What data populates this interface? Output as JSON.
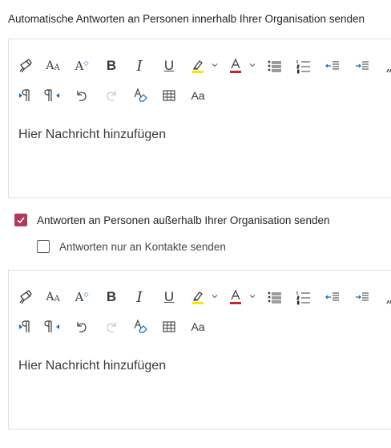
{
  "internal": {
    "title": "Automatische Antworten an Personen innerhalb Ihrer Organisation senden",
    "editor": {
      "placeholder": "Hier Nachricht hinzufügen"
    }
  },
  "external": {
    "reply_checkbox": {
      "label": "Antworten an Personen außerhalb Ihrer Organisation senden",
      "checked": true
    },
    "contacts_checkbox": {
      "label": "Antworten nur an Kontakte senden",
      "checked": false
    },
    "editor": {
      "placeholder": "Hier Nachricht hinzufügen"
    }
  },
  "toolbar": {
    "row1": [
      "format-painter-icon",
      "font-size-icon",
      "grow-font-icon",
      "bold-icon",
      "italic-icon",
      "underline-icon",
      "highlight-icon",
      "font-color-icon",
      "bullets-icon",
      "numbering-icon",
      "decrease-indent-icon",
      "increase-indent-icon",
      "quote-icon"
    ],
    "row2": [
      "ltr-icon",
      "rtl-icon",
      "undo-icon",
      "redo-icon",
      "clear-formatting-icon",
      "table-icon",
      "change-case-icon"
    ],
    "labels": {
      "bold": "B",
      "italic": "I",
      "underline": "U",
      "change_case": "Aa",
      "font_size": "A",
      "grow_font": "A",
      "font_color": "A"
    }
  },
  "colors": {
    "accent": "#b03a5b",
    "highlight": "#ffe400",
    "font_color": "#c4262e",
    "blue_arrow": "#0f6cbd",
    "border": "#e1dfdd",
    "text": "#252423"
  }
}
